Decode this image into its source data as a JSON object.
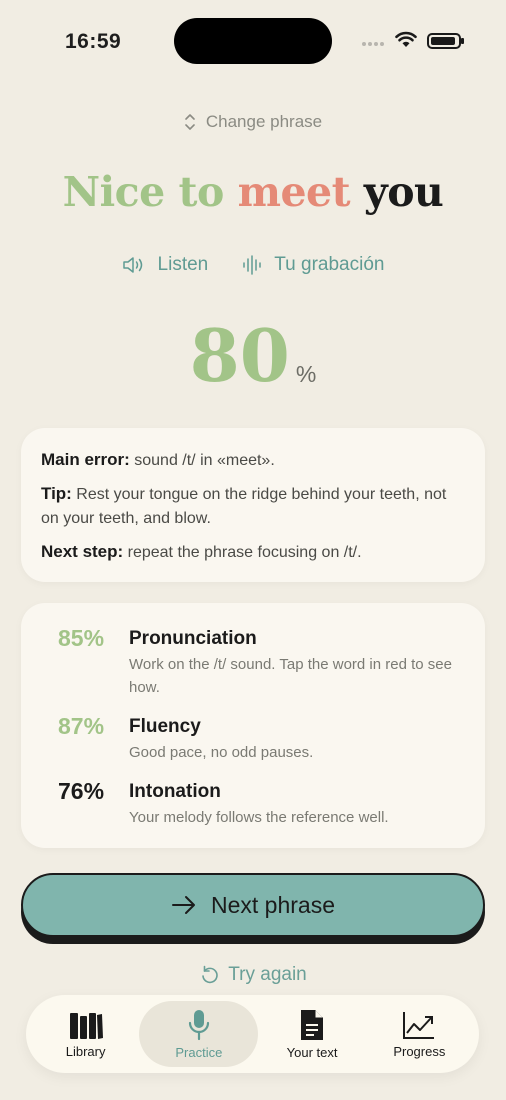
{
  "status": {
    "time": "16:59"
  },
  "header": {
    "change_phrase": "Change phrase"
  },
  "phrase": {
    "words": [
      {
        "text": "Nice",
        "color": "#a2c488"
      },
      {
        "text": "to",
        "color": "#a2c488"
      },
      {
        "text": "meet",
        "color": "#e58a77"
      },
      {
        "text": "you",
        "color": "#1b1b1b"
      }
    ]
  },
  "audio": {
    "listen": "Listen",
    "recording": "Tu grabación"
  },
  "score": {
    "value": "80",
    "unit": "%"
  },
  "feedback": {
    "main_error_label": "Main error:",
    "main_error_text": " sound /t/ in «meet».",
    "tip_label": "Tip:",
    "tip_text": " Rest your tongue on the ridge behind your teeth, not on your teeth, and blow.",
    "next_step_label": "Next step:",
    "next_step_text": " repeat the phrase focusing on /t/."
  },
  "metrics": [
    {
      "pct": "85%",
      "title": "Pronunciation",
      "desc": "Work on the /t/ sound. Tap the word in red to see how."
    },
    {
      "pct": "87%",
      "title": "Fluency",
      "desc": "Good pace, no odd pauses."
    },
    {
      "pct": "76%",
      "title": "Intonation",
      "desc": "Your melody follows the reference well."
    }
  ],
  "actions": {
    "next_phrase": "Next phrase",
    "try_again": "Try again"
  },
  "tabs": [
    {
      "label": "Library",
      "icon": "books-icon"
    },
    {
      "label": "Practice",
      "icon": "microphone-icon",
      "active": true
    },
    {
      "label": "Your text",
      "icon": "document-icon"
    },
    {
      "label": "Progress",
      "icon": "chart-line-icon"
    }
  ],
  "colors": {
    "background": "#f1ede3",
    "accent": "#80b5ad",
    "good": "#a2c488",
    "error": "#e58a77"
  }
}
